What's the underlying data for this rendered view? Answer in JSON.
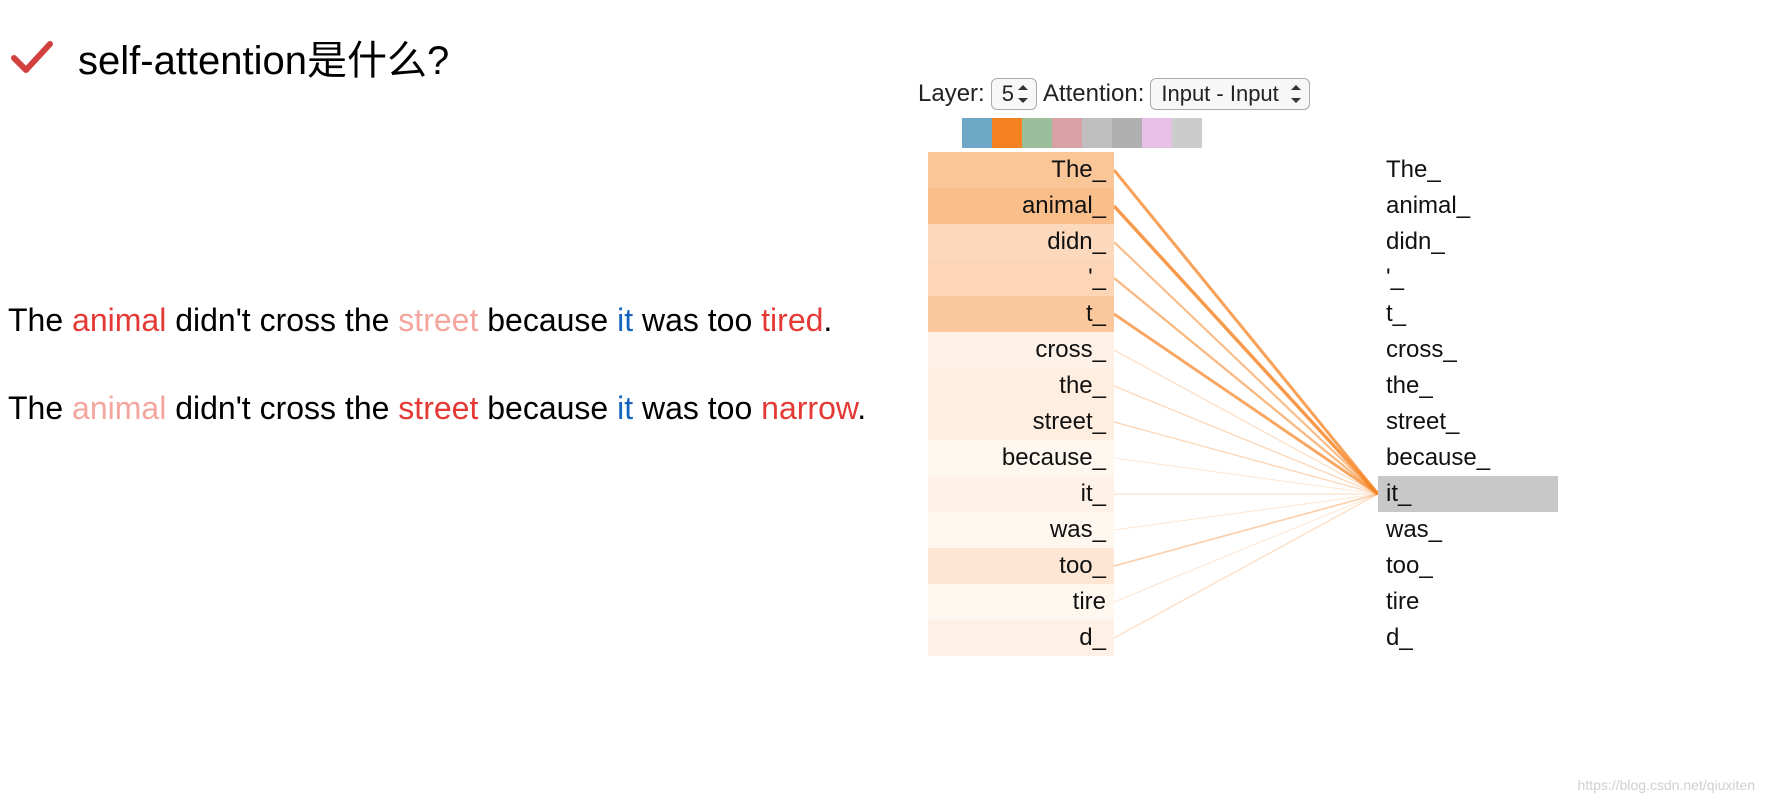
{
  "title": "self-attention是什么?",
  "sentences": {
    "s1": {
      "p1": "The ",
      "animal": "animal",
      "p2": " didn't cross the ",
      "street": "street",
      "p3": " because ",
      "it": "it",
      "p4": " was too ",
      "last": "tired",
      "p5": "."
    },
    "s2": {
      "p1": "The ",
      "animal": "animal",
      "p2": " didn't cross the ",
      "street": "street",
      "p3": " because ",
      "it": "it",
      "p4": " was too ",
      "last": "narrow",
      "p5": "."
    }
  },
  "viz": {
    "layer_label": "Layer:",
    "layer_value": "5",
    "attention_label": "Attention:",
    "attention_value": "Input - Input",
    "head_colors": [
      "#6fa8c7",
      "#f58220",
      "#9bbf9b",
      "#d9a0a6",
      "#bfbfbf",
      "#b0b0b0",
      "#e7c0e7",
      "#cccccc"
    ],
    "tokens": [
      "The_",
      "animal_",
      "didn_",
      "'_",
      "t_",
      "cross_",
      "the_",
      "street_",
      "because_",
      "it_",
      "was_",
      "too_",
      "tire",
      "d_"
    ],
    "selected_right_index": 9,
    "attention_weights": [
      0.85,
      0.95,
      0.55,
      0.6,
      0.8,
      0.2,
      0.25,
      0.25,
      0.12,
      0.2,
      0.12,
      0.35,
      0.12,
      0.22
    ]
  },
  "watermark": "https://blog.csdn.net/qiuxiten"
}
